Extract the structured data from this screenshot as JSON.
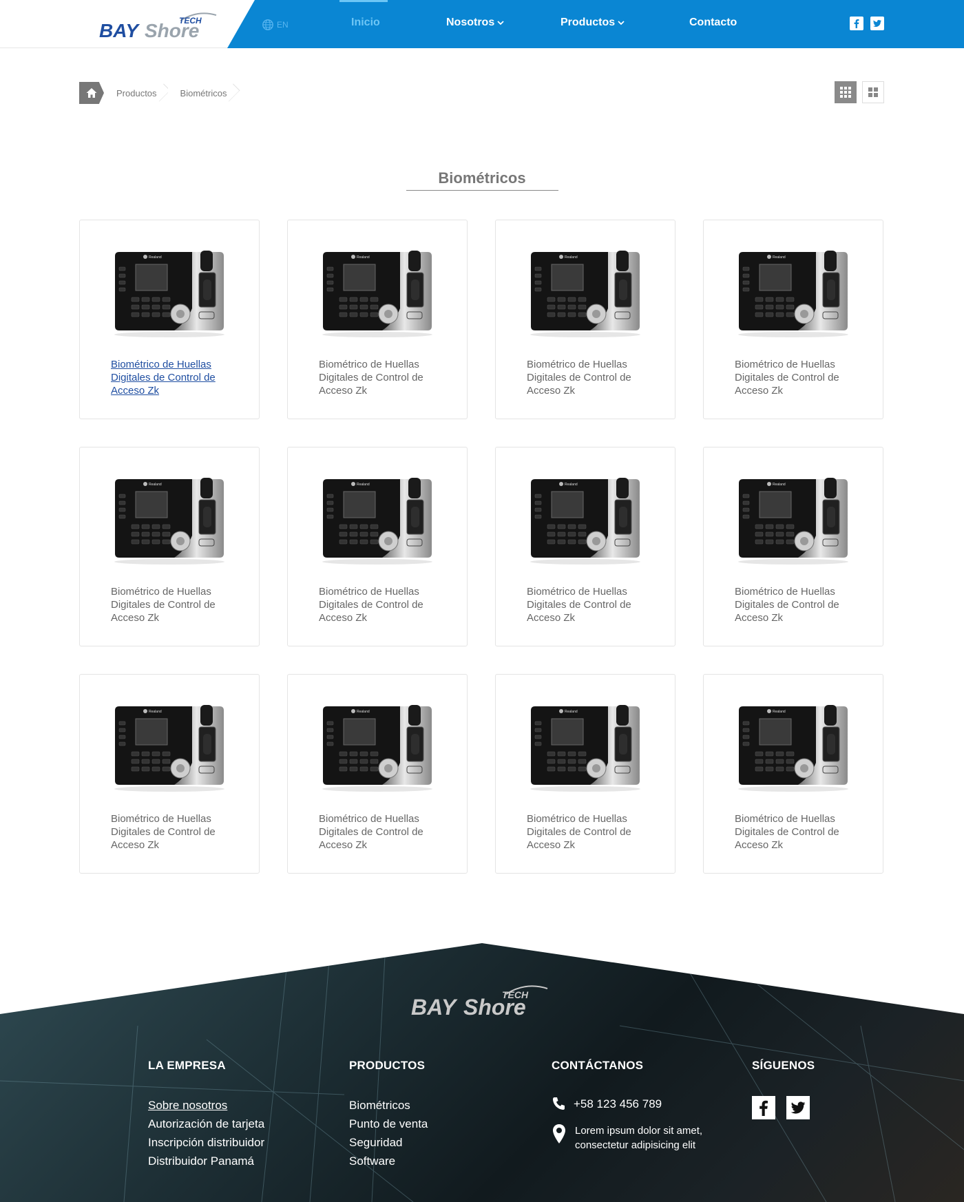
{
  "header": {
    "logo_text": "BAYShore TECH",
    "language": "EN",
    "nav": [
      {
        "label": "Inicio",
        "active": true,
        "dropdown": false
      },
      {
        "label": "Nosotros",
        "active": false,
        "dropdown": true
      },
      {
        "label": "Productos",
        "active": false,
        "dropdown": true
      },
      {
        "label": "Contacto",
        "active": false,
        "dropdown": false
      }
    ],
    "social": [
      "facebook-icon",
      "twitter-icon"
    ],
    "colors": {
      "bar": "#0a86d3",
      "active": "#6ec6f5",
      "logo_blue": "#1f4ea1"
    }
  },
  "breadcrumb": {
    "items": [
      "Productos",
      "Biométricos"
    ]
  },
  "view_toggle": {
    "active": "grid-3x3",
    "options": [
      "grid-3x3",
      "grid-2x2"
    ]
  },
  "section": {
    "title": "Biométricos"
  },
  "products": [
    {
      "title": "Biométrico de Huellas Digitales de Control de Acceso Zk",
      "hovered": true
    },
    {
      "title": "Biométrico de Huellas Digitales de Control de Acceso Zk",
      "hovered": false
    },
    {
      "title": "Biométrico de Huellas Digitales de Control de Acceso Zk",
      "hovered": false
    },
    {
      "title": "Biométrico de Huellas Digitales de Control de Acceso Zk",
      "hovered": false
    },
    {
      "title": "Biométrico de Huellas Digitales de Control de Acceso Zk",
      "hovered": false
    },
    {
      "title": "Biométrico de Huellas Digitales de Control de Acceso Zk",
      "hovered": false
    },
    {
      "title": "Biométrico de Huellas Digitales de Control de Acceso Zk",
      "hovered": false
    },
    {
      "title": "Biométrico de Huellas Digitales de Control de Acceso Zk",
      "hovered": false
    },
    {
      "title": "Biométrico de Huellas Digitales de Control de Acceso Zk",
      "hovered": false
    },
    {
      "title": "Biométrico de Huellas Digitales de Control de Acceso Zk",
      "hovered": false
    },
    {
      "title": "Biométrico de Huellas Digitales de Control de Acceso Zk",
      "hovered": false
    },
    {
      "title": "Biométrico de Huellas Digitales de Control de Acceso Zk",
      "hovered": false
    }
  ],
  "product_brand": "Realand",
  "footer": {
    "logo_text": "BAYShore TECH",
    "empresa": {
      "heading": "LA EMPRESA",
      "links": [
        "Sobre nosotros",
        "Autorización de tarjeta",
        "Inscripción distribuidor",
        "Distribuidor Panamá"
      ]
    },
    "productos": {
      "heading": "PRODUCTOS",
      "links": [
        "Biométricos",
        "Punto de venta",
        "Seguridad",
        "Software"
      ]
    },
    "contacto": {
      "heading": "CONTÁCTANOS",
      "phone": "+58 123 456 789",
      "address_line1": "Lorem ipsum dolor sit amet,",
      "address_line2": "consectetur adipisicing elit"
    },
    "siguenos": {
      "heading": "SÍGUENOS",
      "icons": [
        "facebook-icon",
        "twitter-icon"
      ]
    }
  }
}
